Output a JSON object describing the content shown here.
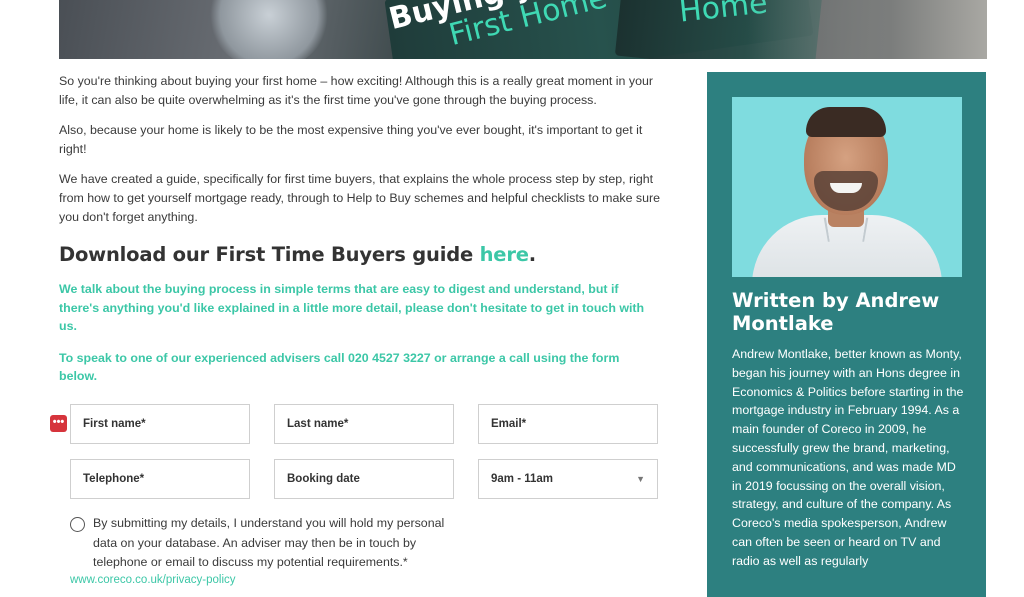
{
  "hero": {
    "text_line1": "Buying y",
    "text_line2": "First Home",
    "text_line3": "Home"
  },
  "intro": {
    "p1": "So you're thinking about buying your first home – how exciting! Although this is a really great moment in your life, it can also be quite overwhelming as it's the first time you've gone through the buying process.",
    "p2": "Also, because your home is likely to be the most expensive thing you've ever bought, it's important to get it right!",
    "p3": "We have created a guide, specifically for first time buyers, that explains the whole process step by step, right from how to get yourself mortgage ready, through to Help to Buy schemes and helpful checklists to make sure you don't forget anything."
  },
  "download": {
    "heading_prefix": "Download our First Time Buyers guide ",
    "link_text": "here",
    "heading_suffix": "."
  },
  "callouts": {
    "c1": "We talk about the buying process in simple terms that are easy to digest and understand, but if there's anything you'd like explained in a little more detail, please don't hesitate to get in touch with us.",
    "c2": "To speak to one of our experienced advisers call 020 4527 3227 or arrange a call using the form below."
  },
  "form": {
    "autofill_icon": "•••",
    "first_name": "First name*",
    "last_name": "Last name*",
    "email": "Email*",
    "telephone": "Telephone*",
    "booking_date": "Booking date",
    "time_slot": "9am - 11am",
    "consent": "By submitting my details, I understand you will hold my personal data on your database. An adviser may then be in touch by telephone or email to discuss my potential requirements.*",
    "privacy_link": "www.coreco.co.uk/privacy-policy"
  },
  "author": {
    "title": "Written by Andrew Montlake",
    "bio": "Andrew Montlake, better known as Monty, began his journey with an Hons degree in Economics & Politics before starting in the mortgage industry in February 1994. As a main founder of Coreco in 2009, he successfully grew the brand, marketing, and communications, and was made MD in 2019 focussing on the overall vision, strategy, and culture of the company. As Coreco's media spokesperson, Andrew can often be seen or heard on TV and radio as well as regularly"
  },
  "colors": {
    "accent": "#3cc7a7",
    "sidebar_bg": "#2d8080",
    "autofill_icon_bg": "#d6343c"
  }
}
